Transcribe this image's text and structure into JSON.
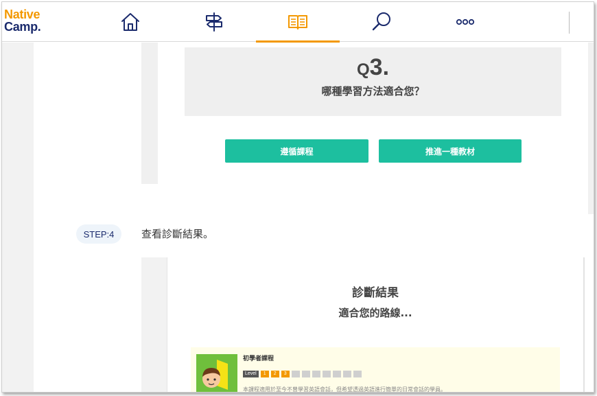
{
  "header": {
    "logo_line1": "Native",
    "logo_line2": "Camp.",
    "nav": [
      {
        "icon": "home-icon"
      },
      {
        "icon": "signpost-icon"
      },
      {
        "icon": "book-icon",
        "active": true
      },
      {
        "icon": "search-icon"
      },
      {
        "icon": "more-icon"
      }
    ]
  },
  "question": {
    "q_prefix": "Q",
    "q_number": "3.",
    "text": "哪種學習方法適合您？",
    "option1": "遵循課程",
    "option2": "推進一種教材"
  },
  "step": {
    "badge": "STEP:4",
    "text": "查看診斷結果。"
  },
  "result": {
    "title": "診斷結果",
    "subtitle": "適合您的路線...",
    "course": {
      "name": "初學者課程",
      "level_label": "Level",
      "levels_active": [
        "1",
        "2",
        "3"
      ],
      "level_current": 3,
      "level_max": 10,
      "description": "本課程適用於至今不曾學習英語會話，但希望透過英語進行簡單的日常會話的學員。"
    }
  },
  "colors": {
    "brand_orange": "#f39800",
    "brand_navy": "#1a2a6c",
    "button_green": "#1dbf9f"
  }
}
